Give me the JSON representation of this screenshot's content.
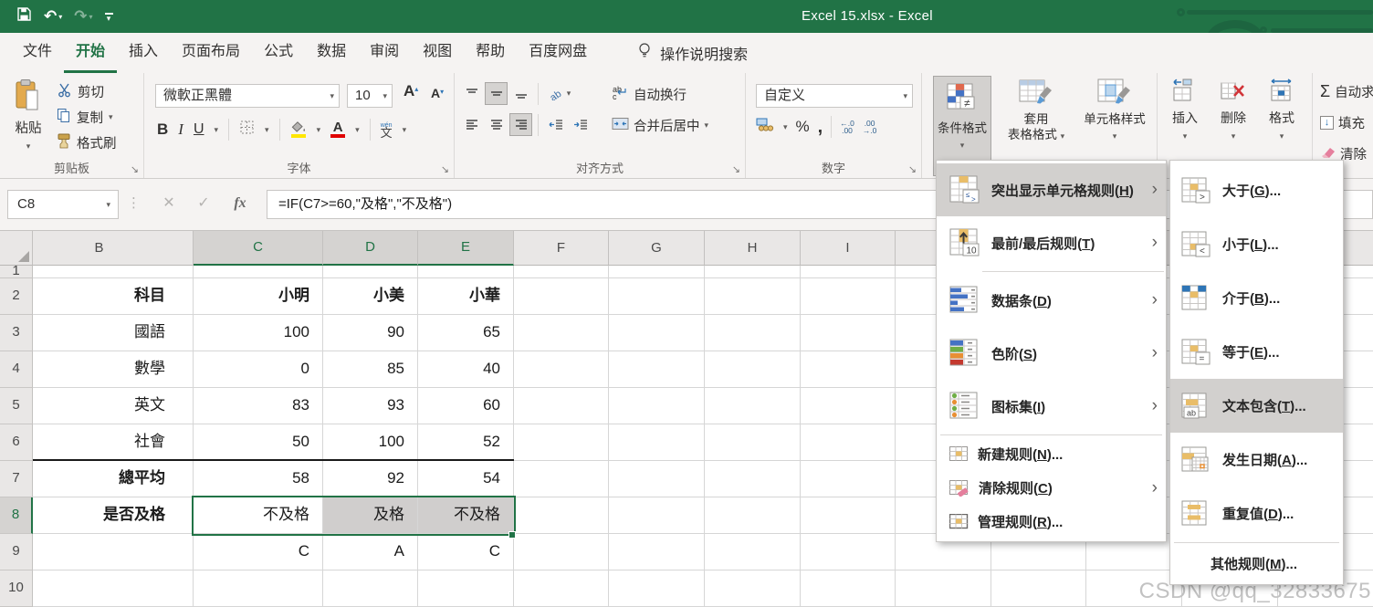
{
  "window": {
    "title": "Excel 15.xlsx  -  Excel"
  },
  "tabs": [
    {
      "label": "文件"
    },
    {
      "label": "开始"
    },
    {
      "label": "插入"
    },
    {
      "label": "页面布局"
    },
    {
      "label": "公式"
    },
    {
      "label": "数据"
    },
    {
      "label": "审阅"
    },
    {
      "label": "视图"
    },
    {
      "label": "帮助"
    },
    {
      "label": "百度网盘"
    }
  ],
  "search": {
    "label": "操作说明搜索"
  },
  "clipboard": {
    "paste": "粘贴",
    "cut": "剪切",
    "copy": "复制",
    "format_painter": "格式刷",
    "group_label": "剪贴板"
  },
  "font": {
    "name": "微軟正黑體",
    "size": "10",
    "bold": "B",
    "italic": "I",
    "underline": "U",
    "phonetic": "文",
    "phonetic_pinyin": "wén",
    "group_label": "字体"
  },
  "alignment": {
    "wrap_text": "自动换行",
    "merge_center": "合并后居中",
    "group_label": "对齐方式"
  },
  "number": {
    "format": "自定义",
    "percent": "%",
    "comma": ",",
    "inc_decimal_top": "←.0",
    "inc_decimal_bottom": ".00",
    "dec_decimal_top": ".00",
    "dec_decimal_bottom": "→.0",
    "group_label": "数字"
  },
  "styles": {
    "conditional_formatting": "条件格式",
    "format_as_table_line1": "套用",
    "format_as_table_line2": "表格格式",
    "cell_styles": "单元格样式"
  },
  "cells_group": {
    "insert": "插入",
    "delete": "删除",
    "format": "格式"
  },
  "editing": {
    "sigma": "Σ",
    "autosum": "自动求和",
    "fill": "填充",
    "clear": "清除"
  },
  "formula_bar": {
    "name_box": "C8",
    "fx": "fx",
    "formula": "=IF(C7>=60,\"及格\",\"不及格\")"
  },
  "sheet": {
    "col_headers": [
      "B",
      "C",
      "D",
      "E",
      "F",
      "G",
      "H",
      "I"
    ],
    "row_numbers": [
      "1",
      "2",
      "3",
      "4",
      "5",
      "6",
      "7",
      "8",
      "9",
      "10"
    ],
    "rows": [
      [
        "",
        "",
        "",
        ""
      ],
      [
        "科目",
        "小明",
        "小美",
        "小華"
      ],
      [
        "國語",
        "100",
        "90",
        "65"
      ],
      [
        "數學",
        "0",
        "85",
        "40"
      ],
      [
        "英文",
        "83",
        "93",
        "60"
      ],
      [
        "社會",
        "50",
        "100",
        "52"
      ],
      [
        "總平均",
        "58",
        "92",
        "54"
      ],
      [
        "是否及格",
        "不及格",
        "及格",
        "不及格"
      ],
      [
        "",
        "C",
        "A",
        "C"
      ],
      [
        "",
        "",
        "",
        ""
      ]
    ]
  },
  "cf_menu": {
    "items": [
      {
        "pre": "突出显示单元格规则(",
        "key": "H",
        "post": ")"
      },
      {
        "pre": "最前/最后规则(",
        "key": "T",
        "post": ")"
      },
      {
        "pre": "数据条(",
        "key": "D",
        "post": ")"
      },
      {
        "pre": "色阶(",
        "key": "S",
        "post": ")"
      },
      {
        "pre": "图标集(",
        "key": "I",
        "post": ")"
      },
      {
        "pre": "新建规则(",
        "key": "N",
        "post": ")..."
      },
      {
        "pre": "清除规则(",
        "key": "C",
        "post": ")"
      },
      {
        "pre": "管理规则(",
        "key": "R",
        "post": ")..."
      }
    ]
  },
  "cf_submenu": {
    "items": [
      {
        "pre": "大于(",
        "key": "G",
        "post": ")..."
      },
      {
        "pre": "小于(",
        "key": "L",
        "post": ")..."
      },
      {
        "pre": "介于(",
        "key": "B",
        "post": ")..."
      },
      {
        "pre": "等于(",
        "key": "E",
        "post": ")..."
      },
      {
        "pre": "文本包含(",
        "key": "T",
        "post": ")..."
      },
      {
        "pre": "发生日期(",
        "key": "A",
        "post": ")..."
      },
      {
        "pre": "重复值(",
        "key": "D",
        "post": ")..."
      },
      {
        "pre": "其他规则(",
        "key": "M",
        "post": ")..."
      }
    ]
  },
  "watermark": "CSDN @qq_32833675",
  "colors": {
    "excel_green": "#217346",
    "menu_highlight": "#d2d0ce",
    "selection_fill": "#d0cecd",
    "fill_yellow": "#ffe600",
    "font_red": "#e00000",
    "bar_blue": "#4472c4"
  }
}
